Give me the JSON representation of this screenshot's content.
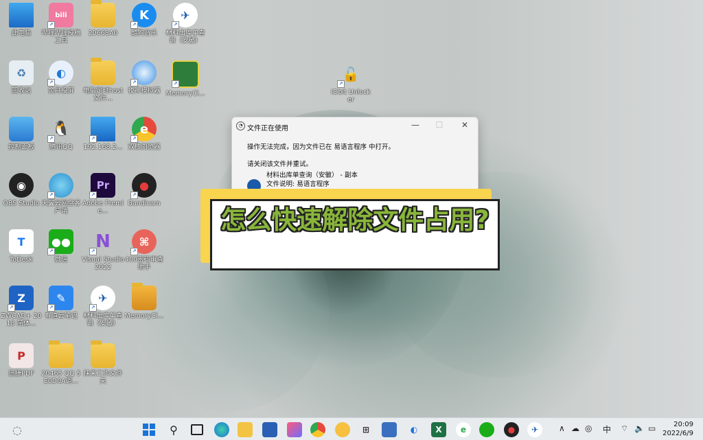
{
  "desktop": {
    "icons": [
      {
        "label": "此电脑"
      },
      {
        "label": "哔哩哔哩投稿工具"
      },
      {
        "label": "20668A0"
      },
      {
        "label": "酷狗音乐"
      },
      {
        "label": "材料出库单查询（安徽）"
      },
      {
        "label": "回收站"
      },
      {
        "label": "金舟投屏"
      },
      {
        "label": "电脑定时host文件..."
      },
      {
        "label": "夜神模拟器"
      },
      {
        "label": "MemoryCl..."
      },
      {
        "label": "IObit Unlocker"
      },
      {
        "label": "控制面板"
      },
      {
        "label": "腾讯QQ"
      },
      {
        "label": "192.168.2..."
      },
      {
        "label": "双核浏览器"
      },
      {
        "label": "OBS Studio"
      },
      {
        "label": "天翼云网盘客户端"
      },
      {
        "label": "Adobe Premie..."
      },
      {
        "label": "Bandicam"
      },
      {
        "label": "ToDesk"
      },
      {
        "label": "微信"
      },
      {
        "label": "Visual Studio 2022"
      },
      {
        "label": "400密码审查助手"
      },
      {
        "label": "ZWCAD+ 2018 简体..."
      },
      {
        "label": "有道云笔记"
      },
      {
        "label": "材料出库单查询（安徽）"
      },
      {
        "label": "MemoryCl..."
      },
      {
        "label": "迅捷PDF"
      },
      {
        "label": "20465 QQ 5E0D0A调..."
      },
      {
        "label": "抹来工作文件夹"
      }
    ]
  },
  "dialog": {
    "title": "文件正在使用",
    "message": "操作无法完成，因为文件已在 易语言程序 中打开。",
    "instruction": "请关闭该文件并重试。",
    "file_name": "材料出库单查询（安徽） - 副本",
    "file_desc": "文件说明: 易语言程序",
    "minimize": "—",
    "maximize": "☐",
    "close": "✕"
  },
  "banner": {
    "text": "怎么快速解除文件占用?"
  },
  "taskbar": {
    "ime": "中",
    "time": "20:09",
    "date": "2022/6/9"
  }
}
